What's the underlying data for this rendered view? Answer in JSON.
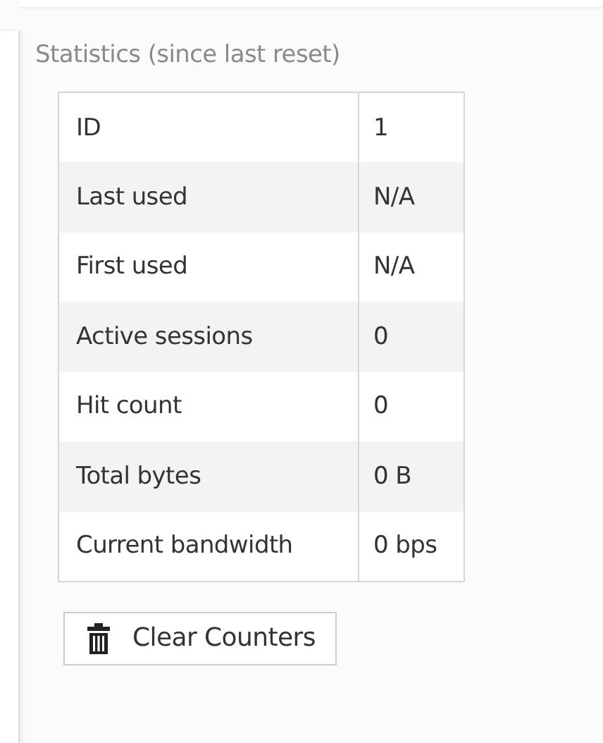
{
  "section": {
    "title": "Statistics (since last reset)"
  },
  "table": {
    "rows": [
      {
        "label": "ID",
        "value": "1"
      },
      {
        "label": "Last used",
        "value": "N/A"
      },
      {
        "label": "First used",
        "value": "N/A"
      },
      {
        "label": "Active sessions",
        "value": "0"
      },
      {
        "label": "Hit count",
        "value": "0"
      },
      {
        "label": "Total bytes",
        "value": "0 B"
      },
      {
        "label": "Current bandwidth",
        "value": "0 bps"
      }
    ]
  },
  "buttons": [
    {
      "label": "Clear Counters"
    }
  ]
}
